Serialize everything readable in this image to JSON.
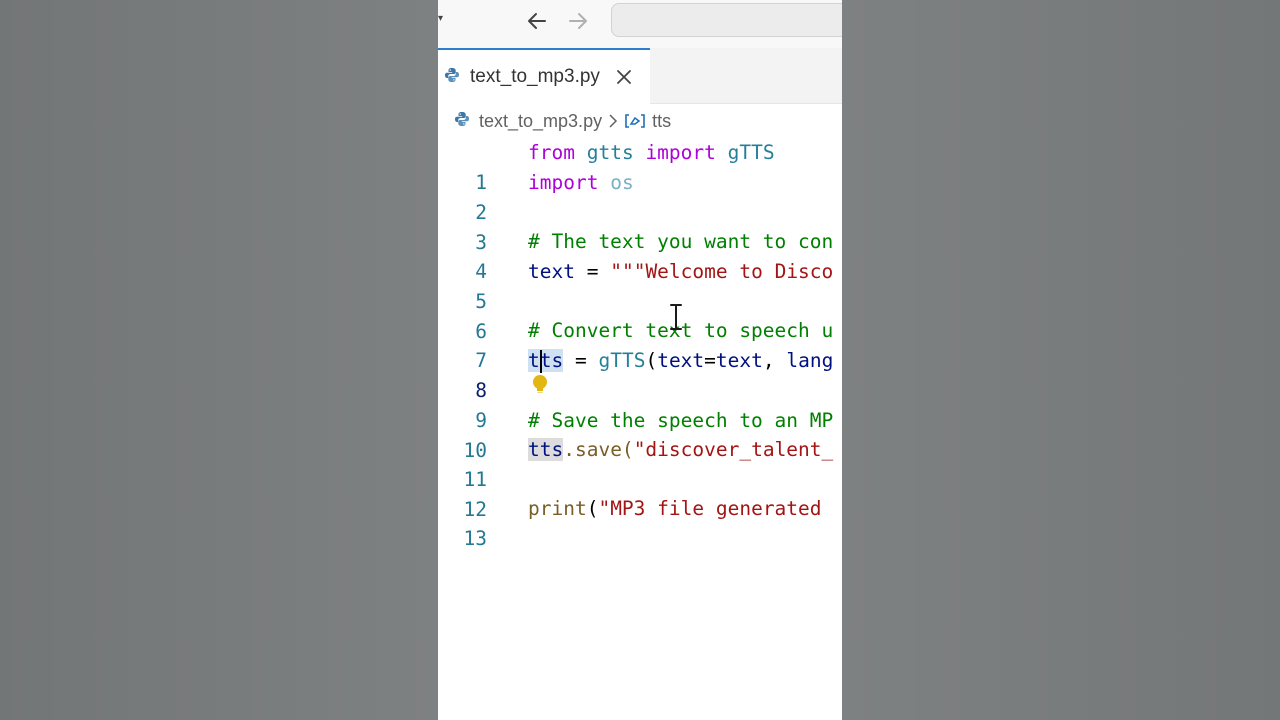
{
  "tab": {
    "filename": "text_to_mp3.py"
  },
  "breadcrumb": {
    "file": "text_to_mp3.py",
    "symbol": "tts"
  },
  "code": {
    "lines": [
      {
        "num": "1",
        "tokens": [
          "from",
          "gtts",
          "import",
          "gTTS"
        ]
      },
      {
        "num": "2",
        "tokens": [
          "import",
          "os"
        ]
      },
      {
        "num": "3",
        "tokens": []
      },
      {
        "num": "4",
        "tokens": [
          "# The text you want to con"
        ]
      },
      {
        "num": "5",
        "tokens": [
          "text",
          "=",
          "\"\"\"Welcome to Disco"
        ]
      },
      {
        "num": "6",
        "tokens": []
      },
      {
        "num": "7",
        "tokens": [
          "# Convert text to speech u"
        ]
      },
      {
        "num": "8",
        "tokens": [
          "tts",
          "=",
          "gTTS",
          "(",
          "text",
          "=",
          "text",
          ", ",
          "lang"
        ]
      },
      {
        "num": "9",
        "tokens": []
      },
      {
        "num": "10",
        "tokens": [
          "# Save the speech to an MP"
        ]
      },
      {
        "num": "11",
        "tokens": [
          "tts",
          ".save(",
          "\"discover_talent_"
        ]
      },
      {
        "num": "12",
        "tokens": []
      },
      {
        "num": "13",
        "tokens": [
          "print",
          "(",
          "\"MP3 file generated "
        ]
      }
    ]
  },
  "colors": {
    "keyword": "#af00db",
    "variable": "#001080",
    "class": "#267f99",
    "comment": "#008000",
    "string": "#a31515",
    "function": "#795e26",
    "line_number": "#237893",
    "active_tab_border": "#2f7ecb",
    "lightbulb": "#e2b714"
  },
  "icons": {
    "back": "arrow-left-icon",
    "forward": "arrow-right-icon",
    "python": "python-icon",
    "close": "close-icon",
    "symbol": "symbol-variable-icon",
    "chevron": "chevron-right-icon",
    "lightbulb": "lightbulb-icon",
    "cursor": "text-cursor-icon"
  }
}
